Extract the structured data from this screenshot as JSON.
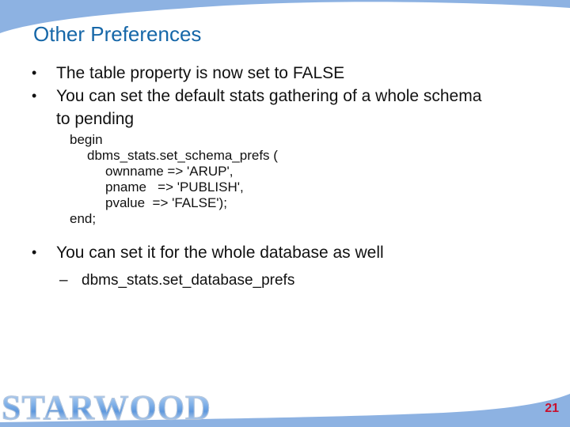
{
  "slide": {
    "title": "Other Preferences",
    "bullets": [
      {
        "text": "The table property is now set to FALSE"
      },
      {
        "text": "You can set the default stats gathering of a whole schema to pending"
      }
    ],
    "code": [
      "begin",
      "dbms_stats.set_schema_prefs (",
      "ownname => 'ARUP',",
      "pname   => 'PUBLISH',",
      "pvalue  => 'FALSE');",
      "end;"
    ],
    "bullet3": {
      "text": "You can set it for the whole database as well"
    },
    "sub_bullet": {
      "text": "dbms_stats.set_database_prefs"
    },
    "bullet_glyph": "•",
    "dash_glyph": "–",
    "logo_text": "STARWOOD",
    "page_number": "21"
  },
  "colors": {
    "title": "#1667a8",
    "swoosh": "#8db2e2",
    "page_number": "#c8102e"
  }
}
